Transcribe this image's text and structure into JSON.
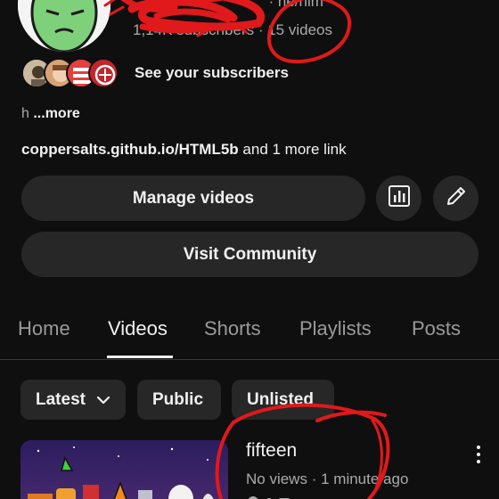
{
  "channel": {
    "handle_visible": "he/him",
    "subscriber_count": "1,14K subscribers",
    "video_count": "15 videos",
    "separator": "·"
  },
  "subscribers": {
    "label": "See your subscribers"
  },
  "description": {
    "prefix": "h",
    "more_label": "...more"
  },
  "links": {
    "primary": "coppersalts.github.io/HTML5b",
    "extra": "and 1 more link"
  },
  "actions": {
    "manage_videos": "Manage videos",
    "analytics_icon": "bar-chart-icon",
    "edit_icon": "pencil-icon",
    "visit_community": "Visit Community"
  },
  "tabs": [
    "Home",
    "Videos",
    "Shorts",
    "Playlists",
    "Posts"
  ],
  "active_tab": "Videos",
  "filters": {
    "sort_label": "Latest",
    "public_label": "Public",
    "unlisted_label": "Unlisted"
  },
  "video": {
    "title": "fifteen",
    "views": "No views",
    "separator": "·",
    "age": "1 minute ago"
  },
  "colors": {
    "background": "#0f0f0f",
    "surface": "#272727",
    "text_primary": "#f1f1f1",
    "text_secondary": "#aaaaaa",
    "annotation_red": "#e0191b"
  }
}
